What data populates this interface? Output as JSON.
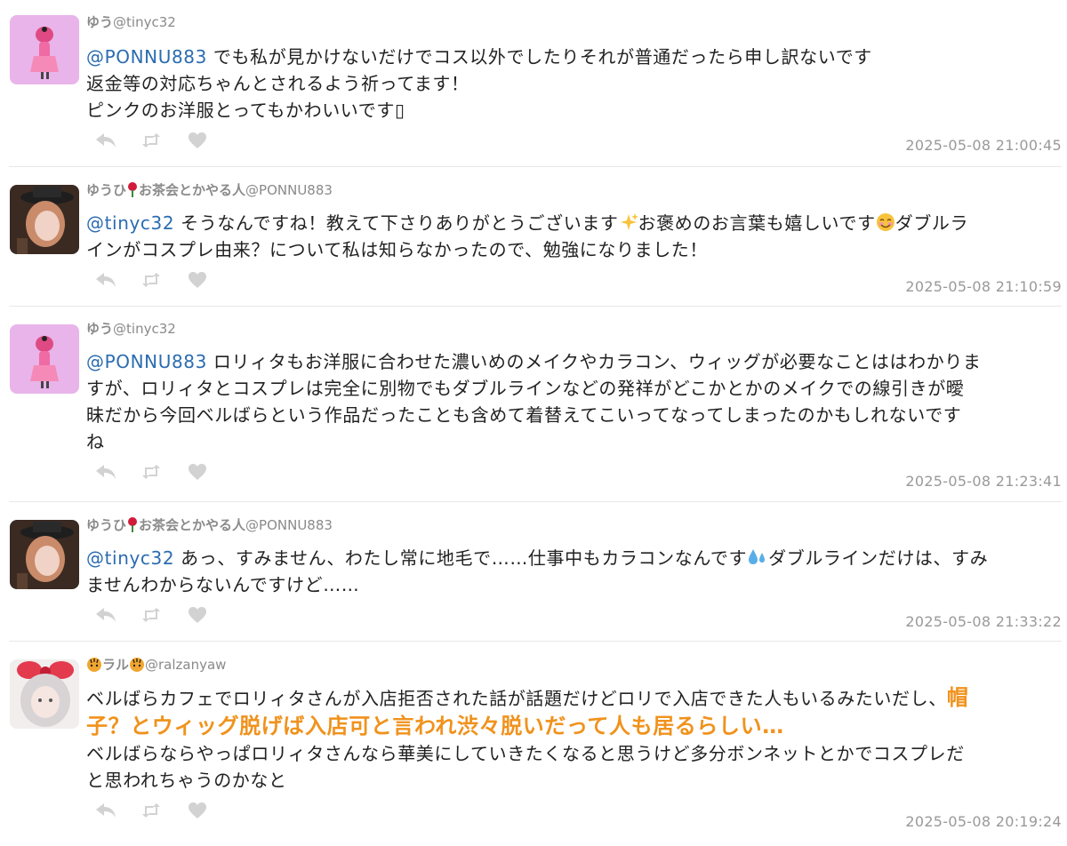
{
  "tweets": [
    {
      "display_name": "ゆう",
      "handle": "@tinyc32",
      "avatar": "pink-figure-avatar",
      "mention": "@PONNU883",
      "lines": [
        "でも私が見かけないだけでコス以外でしたりそれが普通だったら申し訳ないです",
        "返金等の対応ちゃんとされるよう祈ってます！",
        "ピンクのお洋服とってもかわいいです▯"
      ],
      "timestamp": "2025-05-08 21:00:45"
    },
    {
      "display_name": "ゆうひ🌹お茶会とかやる人",
      "name_before_emoji": "ゆうひ",
      "name_after_emoji": "お茶会とかやる人",
      "handle": "@PONNU883",
      "avatar": "hat-girl-avatar",
      "mention": "@tinyc32",
      "text_a": "そうなんですね！教えて下さりありがとうございます",
      "text_b": "お褒めのお言葉も嬉しいです",
      "text_c": "ダブルラ",
      "line2": "インがコスプレ由来？について私は知らなかったので、勉強になりました！",
      "timestamp": "2025-05-08 21:10:59"
    },
    {
      "display_name": "ゆう",
      "handle": "@tinyc32",
      "avatar": "pink-figure-avatar",
      "mention": "@PONNU883",
      "line1": "ロリィタもお洋服に合わせた濃いめのメイクやカラコン、ウィッグが必要なことははわかりま",
      "line2": "すが、ロリィタとコスプレは完全に別物でもダブルラインなどの発祥がどこかとかのメイクでの線引きが曖",
      "line3": "昧だから今回ベルばらという作品だったことも含めて着替えてこいってなってしまったのかもしれないです",
      "line4": "ね",
      "timestamp": "2025-05-08 21:23:41"
    },
    {
      "display_name": "ゆうひ🌹お茶会とかやる人",
      "name_before_emoji": "ゆうひ",
      "name_after_emoji": "お茶会とかやる人",
      "handle": "@PONNU883",
      "avatar": "hat-girl-avatar",
      "mention": "@tinyc32",
      "text_a": "あっ、すみません、わたし常に地毛で……仕事中もカラコンなんです",
      "text_b": "ダブルラインだけは、すみ",
      "line2": "ませんわからないんですけど……",
      "timestamp": "2025-05-08 21:33:22"
    },
    {
      "display_name": "🐯ラル🐯",
      "name_middle": "ラル",
      "handle": "@ralzanyaw",
      "avatar": "ribbon-girl-avatar",
      "line1": "ベルばらカフェでロリィタさんが入店拒否された話が話題だけどロリで入店できた人もいるみたいだし、",
      "hl1": "帽",
      "hl2": "子？とウィッグ脱げば入店可と言われ渋々脱いだって人も居るらしい…",
      "line3": "ベルばらならやっぱロリィタさんなら華美にしていきたくなると思うけど多分ボンネットとかでコスプレだ",
      "line4": "と思われちゃうのかなと",
      "timestamp": "2025-05-08 20:19:24"
    }
  ],
  "icons": {
    "reply": "reply-icon",
    "retweet": "retweet-icon",
    "like": "heart-icon"
  },
  "colors": {
    "mention": "#2b6cb0",
    "highlight": "#f0921c",
    "meta": "#999999",
    "action_icon": "#d2d2d2"
  }
}
